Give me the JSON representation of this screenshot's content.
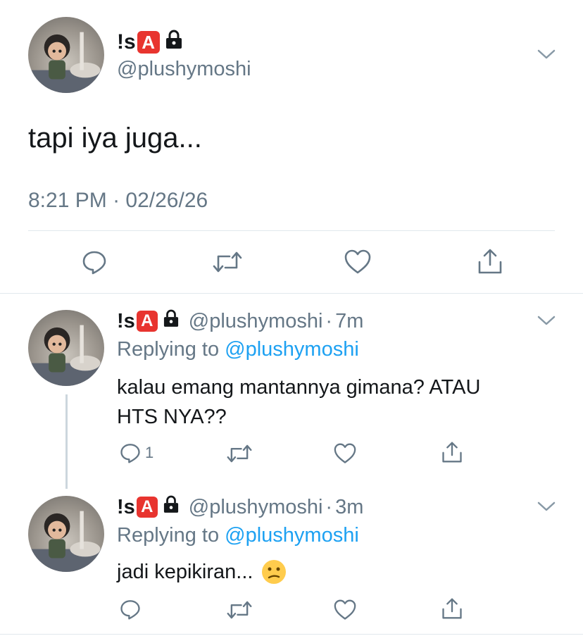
{
  "main_tweet": {
    "display_name": "!s",
    "badge": "A",
    "handle": "@plushymoshi",
    "text": "tapi iya juga...",
    "time": "8:21 PM",
    "date": "02/26/26",
    "time_separator": "·"
  },
  "replies": [
    {
      "display_name": "!s",
      "badge": "A",
      "handle": "@plushymoshi",
      "separator": "·",
      "age": "7m",
      "replying_prefix": "Replying to",
      "replying_to": "@plushymoshi",
      "text_line1": "kalau emang mantannya gimana? ATAU",
      "text_line2": "HTS NYA??",
      "reply_count": "1"
    },
    {
      "display_name": "!s",
      "badge": "A",
      "handle": "@plushymoshi",
      "separator": "·",
      "age": "3m",
      "replying_prefix": "Replying to",
      "replying_to": "@plushymoshi",
      "text": "jadi kepikiran...",
      "emoji": "😕"
    }
  ],
  "icons": {
    "reply": "reply-icon",
    "retweet": "retweet-icon",
    "like": "heart-icon",
    "share": "share-icon",
    "menu": "chevron-down-icon",
    "lock": "lock-icon"
  },
  "colors": {
    "link": "#1da1f2",
    "muted": "#657786",
    "badge": "#e8342f",
    "divider": "#e1e8ed"
  }
}
